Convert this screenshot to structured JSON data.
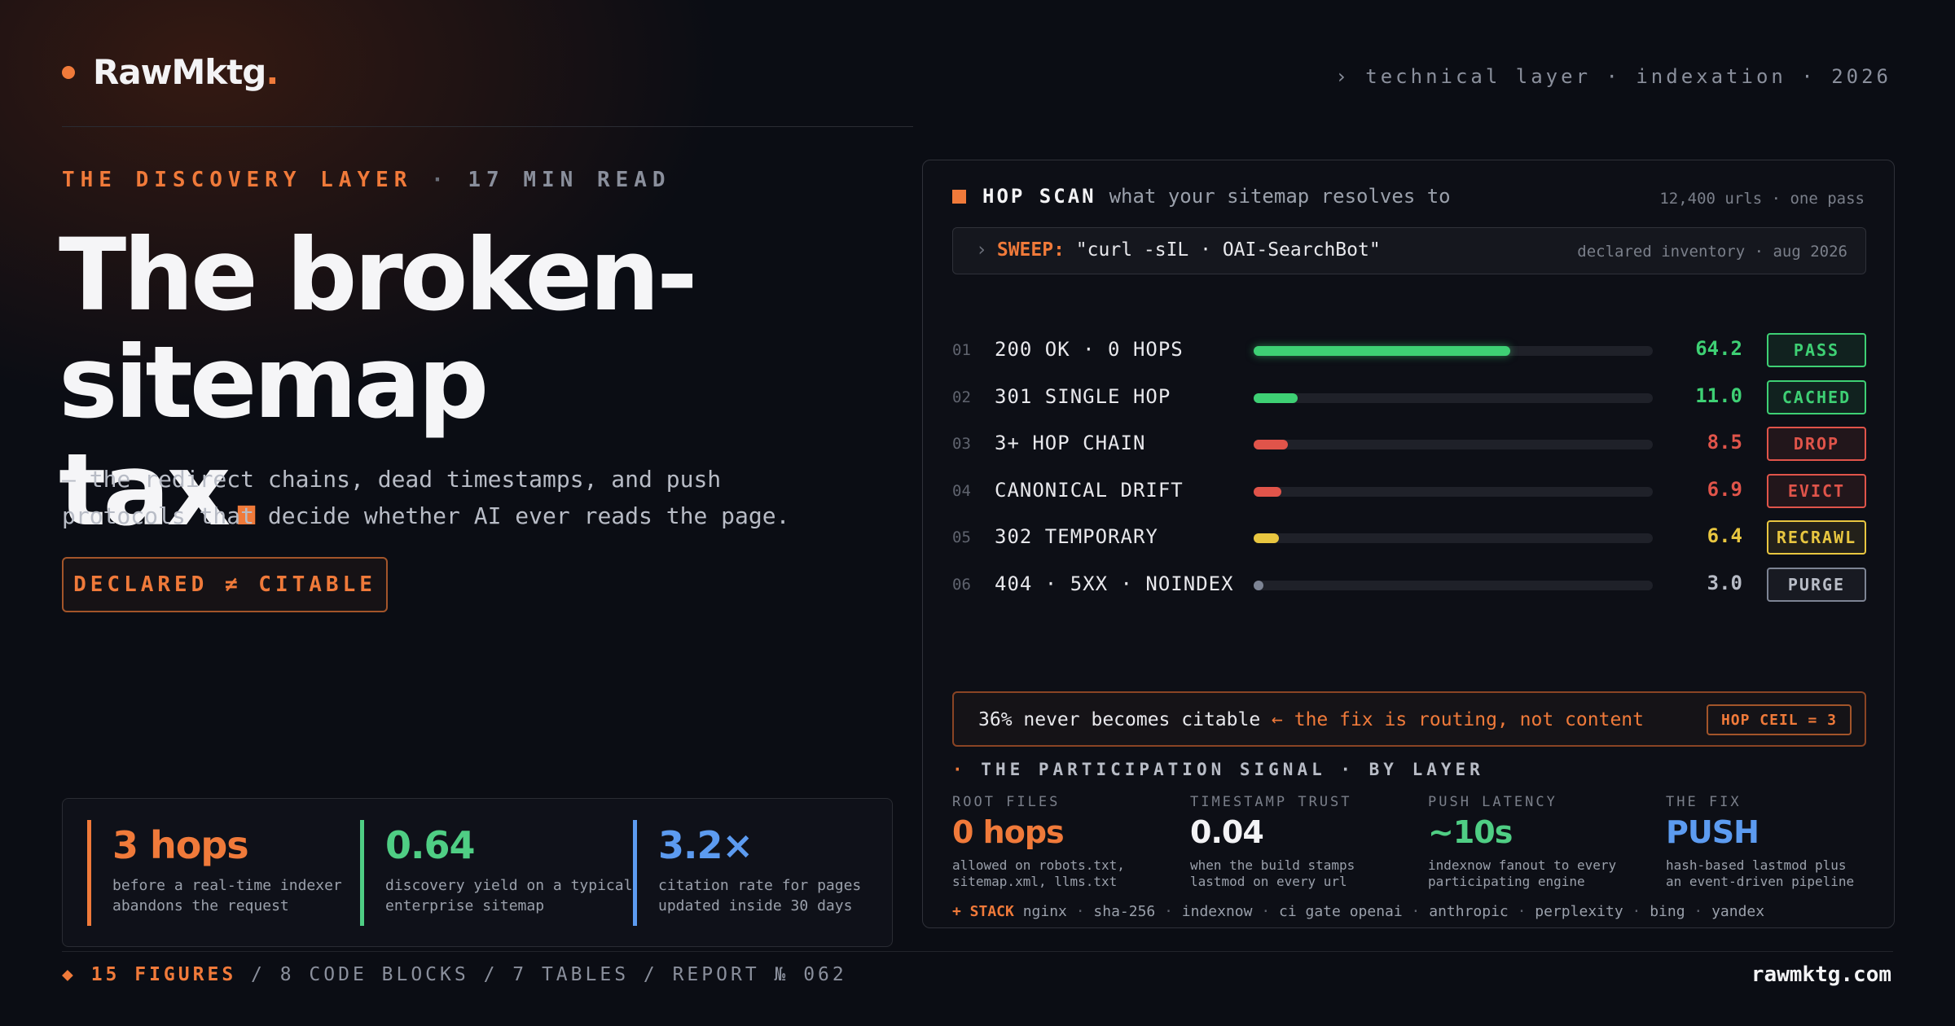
{
  "brand": {
    "name": "RawMktg",
    "suffix": "."
  },
  "top_tag": "› technical layer · indexation · 2026",
  "eyebrow": {
    "section": "THE DISCOVERY LAYER",
    "sep": " · ",
    "read": "17 MIN READ"
  },
  "headline": {
    "line1": "The broken-sitemap",
    "line2": "tax",
    "suffix": "."
  },
  "lede": {
    "line1": "— the redirect chains, dead timestamps, and push",
    "line2": "protocols that decide whether AI ever reads the page."
  },
  "pill": "DECLARED ≠ CITABLE",
  "stats": [
    {
      "value": "3 hops",
      "desc1": "before a real-time indexer",
      "desc2": "abandons the request",
      "color": "#f07a3a"
    },
    {
      "value": "0.64",
      "desc1": "discovery yield on a typical",
      "desc2": "enterprise sitemap",
      "color": "#4fce84"
    },
    {
      "value": "3.2×",
      "desc1": "citation rate for pages",
      "desc2": "updated inside 30 days",
      "color": "#5c9bf0"
    }
  ],
  "footer": {
    "left_hl": "◆ 15 FIGURES",
    "left_rest": " / 8 CODE BLOCKS / 7 TABLES / REPORT № 062",
    "right": "rawmktg.com"
  },
  "panel": {
    "title": "HOP SCAN",
    "subtitle": "what your sitemap resolves to",
    "meta": "12,400 urls · one pass",
    "sweep": {
      "chev": "›",
      "key": "SWEEP:",
      "cmd": " \"curl -sIL · OAI-SearchBot\"",
      "note": "declared inventory · aug 2026"
    },
    "rows": [
      {
        "num": "01",
        "label": "200 OK · 0 HOPS",
        "value": "64.2",
        "percent": 64.2,
        "badge": "PASS",
        "color": "#3ed074"
      },
      {
        "num": "02",
        "label": "301 SINGLE HOP",
        "value": "11.0",
        "percent": 11.0,
        "badge": "CACHED",
        "color": "#3ed074"
      },
      {
        "num": "03",
        "label": "3+ HOP CHAIN",
        "value": "8.5",
        "percent": 8.5,
        "badge": "DROP",
        "color": "#e0544a"
      },
      {
        "num": "04",
        "label": "CANONICAL DRIFT",
        "value": "6.9",
        "percent": 6.9,
        "badge": "EVICT",
        "color": "#e0544a"
      },
      {
        "num": "05",
        "label": "302 TEMPORARY",
        "value": "6.4",
        "percent": 6.4,
        "badge": "RECRAWL",
        "color": "#e8c640"
      },
      {
        "num": "06",
        "label": "404 · 5XX · NOINDEX",
        "value": "3.0",
        "percent": 1.2,
        "badge": "PURGE",
        "color": "#7d8494"
      }
    ],
    "alert": {
      "text": "36% never becomes citable ",
      "hl": "← the fix is routing, not content",
      "badge": "HOP CEIL = 3"
    },
    "signal": {
      "title_dot": "·",
      "title": " THE PARTICIPATION SIGNAL · BY LAYER",
      "items": [
        {
          "label": "ROOT FILES",
          "value": "0 hops",
          "desc1": "allowed on robots.txt,",
          "desc2": "sitemap.xml, llms.txt",
          "color": "#f07a3a"
        },
        {
          "label": "TIMESTAMP TRUST",
          "value": "0.04",
          "desc1": "when the build stamps",
          "desc2": "lastmod on every url",
          "color": "#f3f3f5"
        },
        {
          "label": "PUSH LATENCY",
          "value": "~10s",
          "desc1": "indexnow fanout to every",
          "desc2": "participating engine",
          "color": "#4fce84"
        },
        {
          "label": "THE FIX",
          "value": "PUSH",
          "desc1": "hash-based lastmod plus",
          "desc2": "an event-driven pipeline",
          "color": "#5c9bf0"
        }
      ]
    },
    "stack": {
      "hl": "+ STACK",
      "items": [
        "nginx",
        "sha-256",
        "indexnow",
        "ci gate openai",
        "anthropic",
        "perplexity",
        "bing",
        "yandex"
      ]
    }
  }
}
